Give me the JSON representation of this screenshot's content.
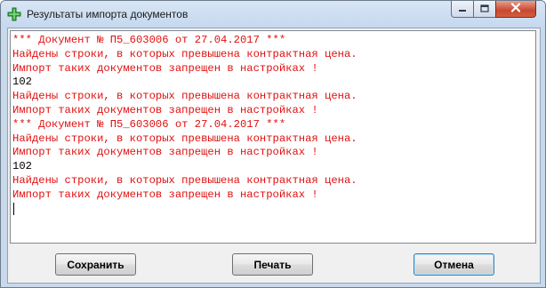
{
  "window": {
    "title": "Результаты импорта документов"
  },
  "titlebar_icons": {
    "app": "green-cross-icon",
    "minimize": "minimize-icon",
    "maximize": "maximize-icon",
    "close": "close-icon"
  },
  "log": {
    "lines": [
      {
        "text": "*** Документ № П5_603006 от 27.04.2017 ***",
        "color": "#e01010"
      },
      {
        "text": "Найдены строки, в которых превышена контрактная цена.",
        "color": "#e01010"
      },
      {
        "text": "Импорт таких документов запрещен в настройках !",
        "color": "#e01010"
      },
      {
        "text": "102",
        "color": "#000000"
      },
      {
        "text": "Найдены строки, в которых превышена контрактная цена.",
        "color": "#e01010"
      },
      {
        "text": "Импорт таких документов запрещен в настройках !",
        "color": "#e01010"
      },
      {
        "text": "*** Документ № П5_603006 от 27.04.2017 ***",
        "color": "#e01010"
      },
      {
        "text": "Найдены строки, в которых превышена контрактная цена.",
        "color": "#e01010"
      },
      {
        "text": "Импорт таких документов запрещен в настройках !",
        "color": "#e01010"
      },
      {
        "text": "102",
        "color": "#000000"
      },
      {
        "text": "Найдены строки, в которых превышена контрактная цена.",
        "color": "#e01010"
      },
      {
        "text": "Импорт таких документов запрещен в настройках !",
        "color": "#e01010"
      }
    ]
  },
  "buttons": {
    "save": "Сохранить",
    "print": "Печать",
    "cancel": "Отмена"
  },
  "colors": {
    "error_text": "#e01010",
    "normal_text": "#000000"
  }
}
